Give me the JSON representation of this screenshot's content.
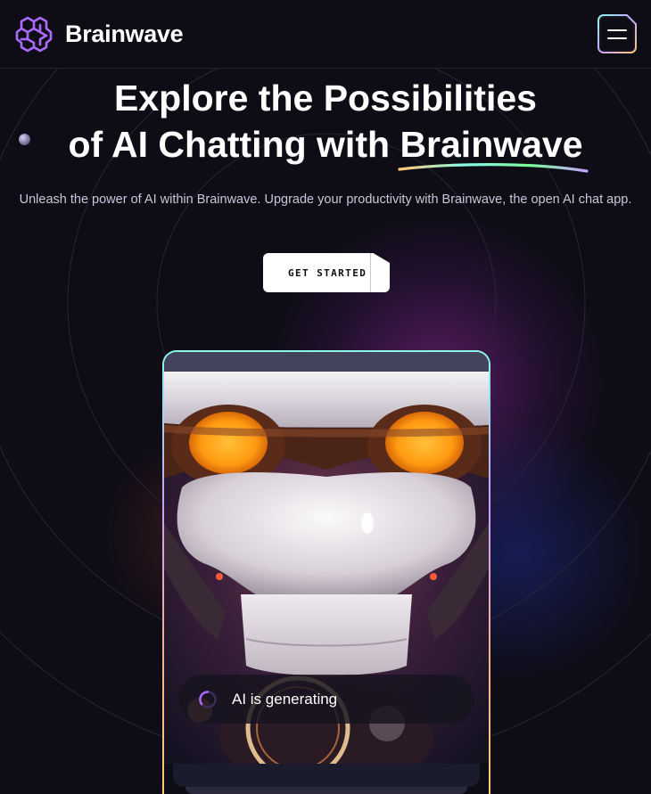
{
  "brand": {
    "name": "Brainwave",
    "logo_icon": "brain-circuit-icon",
    "accent_color": "#ac6aff"
  },
  "header": {
    "menu_icon": "hamburger-menu-icon"
  },
  "hero": {
    "title_line1": "Explore the Possibilities",
    "title_line2_prefix": "of AI Chatting with",
    "title_highlight": "Brainwave",
    "subtitle": "Unleash the power of AI within Brainwave. Upgrade your productivity with Brainwave, the open AI chat app.",
    "cta_label": "GET STARTED"
  },
  "device": {
    "status_text": "AI is generating",
    "status_icon": "loading-spinner-icon",
    "image": "robot-face-illustration"
  },
  "colors": {
    "background": "#0e0c15",
    "border": "#252134",
    "gradient": [
      "#89f9e8",
      "#c7a1ff",
      "#fbb28a",
      "#ffc876"
    ]
  }
}
